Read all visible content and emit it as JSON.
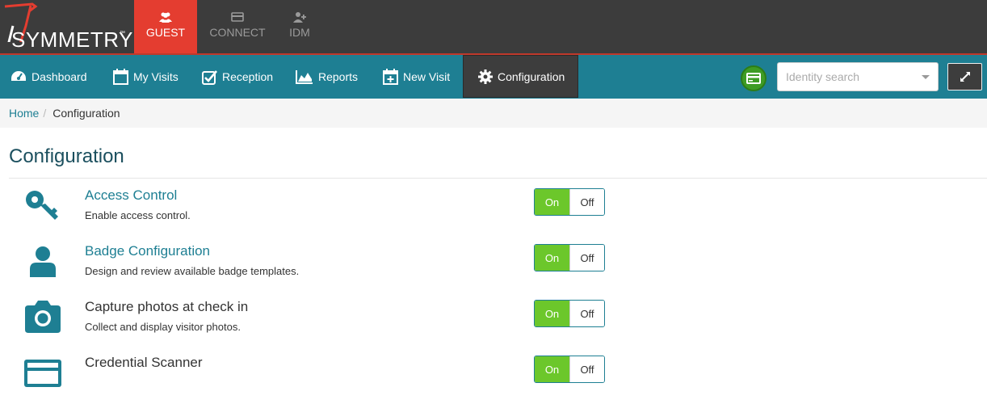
{
  "brand": {
    "name": "SYMMETRY",
    "tm": "™"
  },
  "app_tabs": [
    {
      "label": "GUEST",
      "icon": "users-icon",
      "active": true
    },
    {
      "label": "CONNECT",
      "icon": "card-icon",
      "active": false
    },
    {
      "label": "IDM",
      "icon": "user-plus-icon",
      "active": false
    }
  ],
  "nav": [
    {
      "label": "Dashboard",
      "icon": "dashboard-icon"
    },
    {
      "label": "My Visits",
      "icon": "calendar-icon"
    },
    {
      "label": "Reception",
      "icon": "checkbox-icon"
    },
    {
      "label": "Reports",
      "icon": "area-chart-icon"
    },
    {
      "label": "New Visit",
      "icon": "calendar-plus-icon"
    },
    {
      "label": "Configuration",
      "icon": "gear-icon",
      "active": true
    }
  ],
  "search": {
    "placeholder": "Identity search"
  },
  "breadcrumb": {
    "home": "Home",
    "separator": "/",
    "current": "Configuration"
  },
  "page": {
    "title": "Configuration"
  },
  "settings": [
    {
      "name": "Access Control",
      "description": "Enable access control.",
      "icon": "key-icon",
      "link": true,
      "on_label": "On",
      "off_label": "Off",
      "state": "on"
    },
    {
      "name": "Badge Configuration",
      "description": "Design and review available badge templates.",
      "icon": "user-icon",
      "link": true,
      "on_label": "On",
      "off_label": "Off",
      "state": "on"
    },
    {
      "name": "Capture photos at check in",
      "description": "Collect and display visitor photos.",
      "icon": "camera-icon",
      "link": false,
      "on_label": "On",
      "off_label": "Off",
      "state": "on"
    },
    {
      "name": "Credential Scanner",
      "description": "",
      "icon": "credit-card-icon",
      "link": false,
      "on_label": "On",
      "off_label": "Off",
      "state": "on"
    }
  ],
  "colors": {
    "topbar": "#3c3c3c",
    "guest_active": "#e43d30",
    "navbar": "#1e7f93",
    "toggle_on": "#6cc72b",
    "card_button": "#3e9c25"
  }
}
